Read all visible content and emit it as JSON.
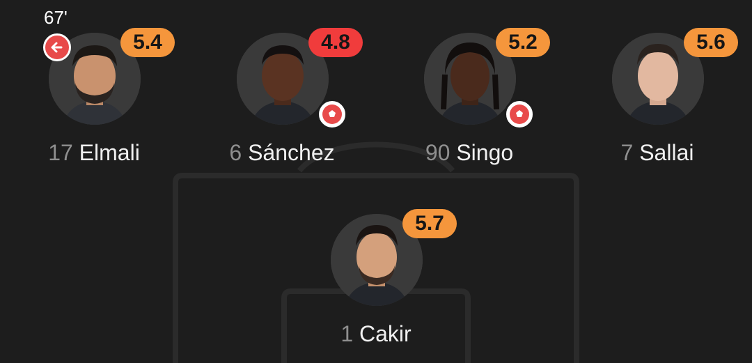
{
  "players": [
    {
      "number": "17",
      "name": "Elmali",
      "rating": "5.4",
      "rating_color": "#f5963c",
      "sub_time": "67'",
      "icon": "substitution-out-icon"
    },
    {
      "number": "6",
      "name": "Sánchez",
      "rating": "4.8",
      "rating_color": "#f03c3c",
      "icon": "football-goal-icon"
    },
    {
      "number": "90",
      "name": "Singo",
      "rating": "5.2",
      "rating_color": "#f5963c",
      "icon": "football-goal-icon"
    },
    {
      "number": "7",
      "name": "Sallai",
      "rating": "5.6",
      "rating_color": "#f5963c"
    },
    {
      "number": "1",
      "name": "Cakir",
      "rating": "5.7",
      "rating_color": "#f5963c"
    }
  ],
  "colors": {
    "background": "#1d1d1d",
    "orange": "#f5963c",
    "red": "#f03c3c",
    "text": "#f0f0f0",
    "number": "#8f8f8f"
  }
}
